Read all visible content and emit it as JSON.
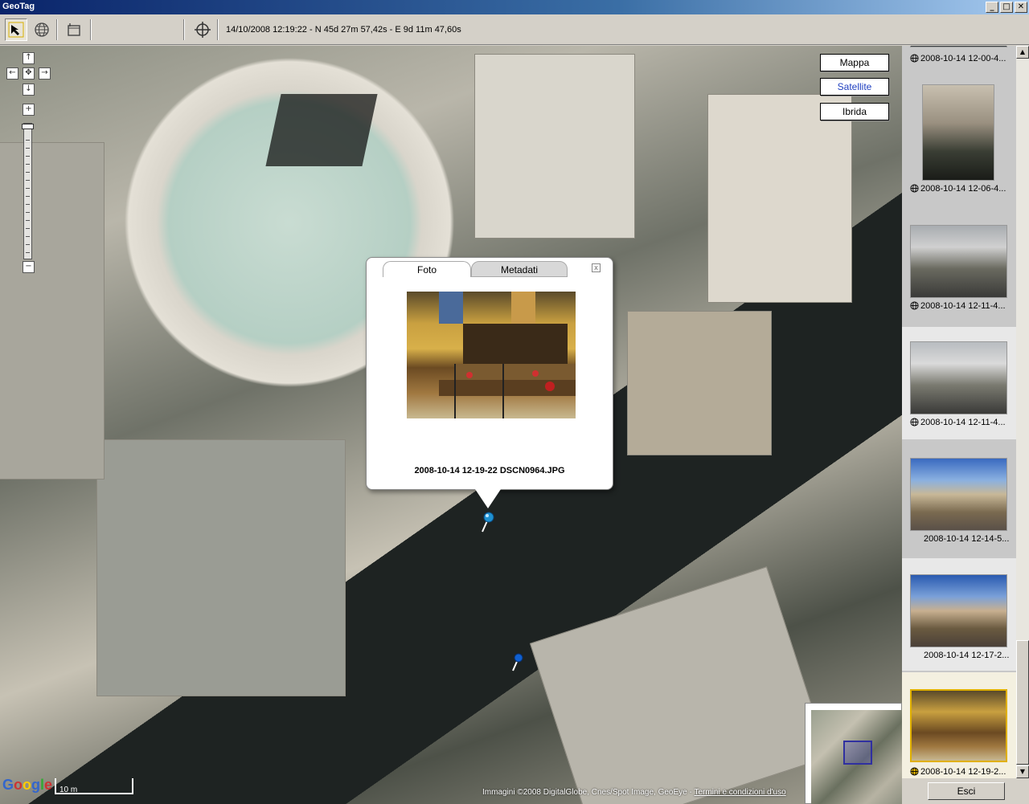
{
  "window": {
    "title": "GeoTag",
    "buttons": [
      "_",
      "□",
      "✕"
    ]
  },
  "toolbar": {
    "tools": [
      "pointer-tool",
      "globe-tool",
      "frame-tool",
      "locate-tool"
    ],
    "status": "14/10/2008 12:19:22 - N 45d 27m 57,42s - E 9d 11m 47,60s"
  },
  "map": {
    "type_buttons": [
      {
        "label": "Mappa",
        "selected": false
      },
      {
        "label": "Satellite",
        "selected": true
      },
      {
        "label": "Ibrida",
        "selected": false
      }
    ],
    "popup": {
      "tabs": [
        "Foto",
        "Metadati"
      ],
      "active_tab": "Foto",
      "close": "x",
      "caption": "2008-10-14 12-19-22 DSCN0964.JPG"
    },
    "logo": "Google",
    "scale": "10 m",
    "copyright": "Immagini ©2008 DigitalGlobe, Cnes/Spot Image, GeoEye -",
    "terms": "Termini e condizioni d'uso"
  },
  "thumbnails": [
    {
      "label": "2008-10-14 12-00-4...",
      "globe": true
    },
    {
      "label": "2008-10-14 12-06-4...",
      "globe": true
    },
    {
      "label": "2008-10-14 12-11-4...",
      "globe": true
    },
    {
      "label": "2008-10-14 12-11-4...",
      "globe": true
    },
    {
      "label": "2008-10-14 12-14-5...",
      "globe": false
    },
    {
      "label": "2008-10-14 12-17-2...",
      "globe": false
    },
    {
      "label": "2008-10-14 12-19-2...",
      "globe": true,
      "selected": true
    }
  ],
  "exit_label": "Esci"
}
